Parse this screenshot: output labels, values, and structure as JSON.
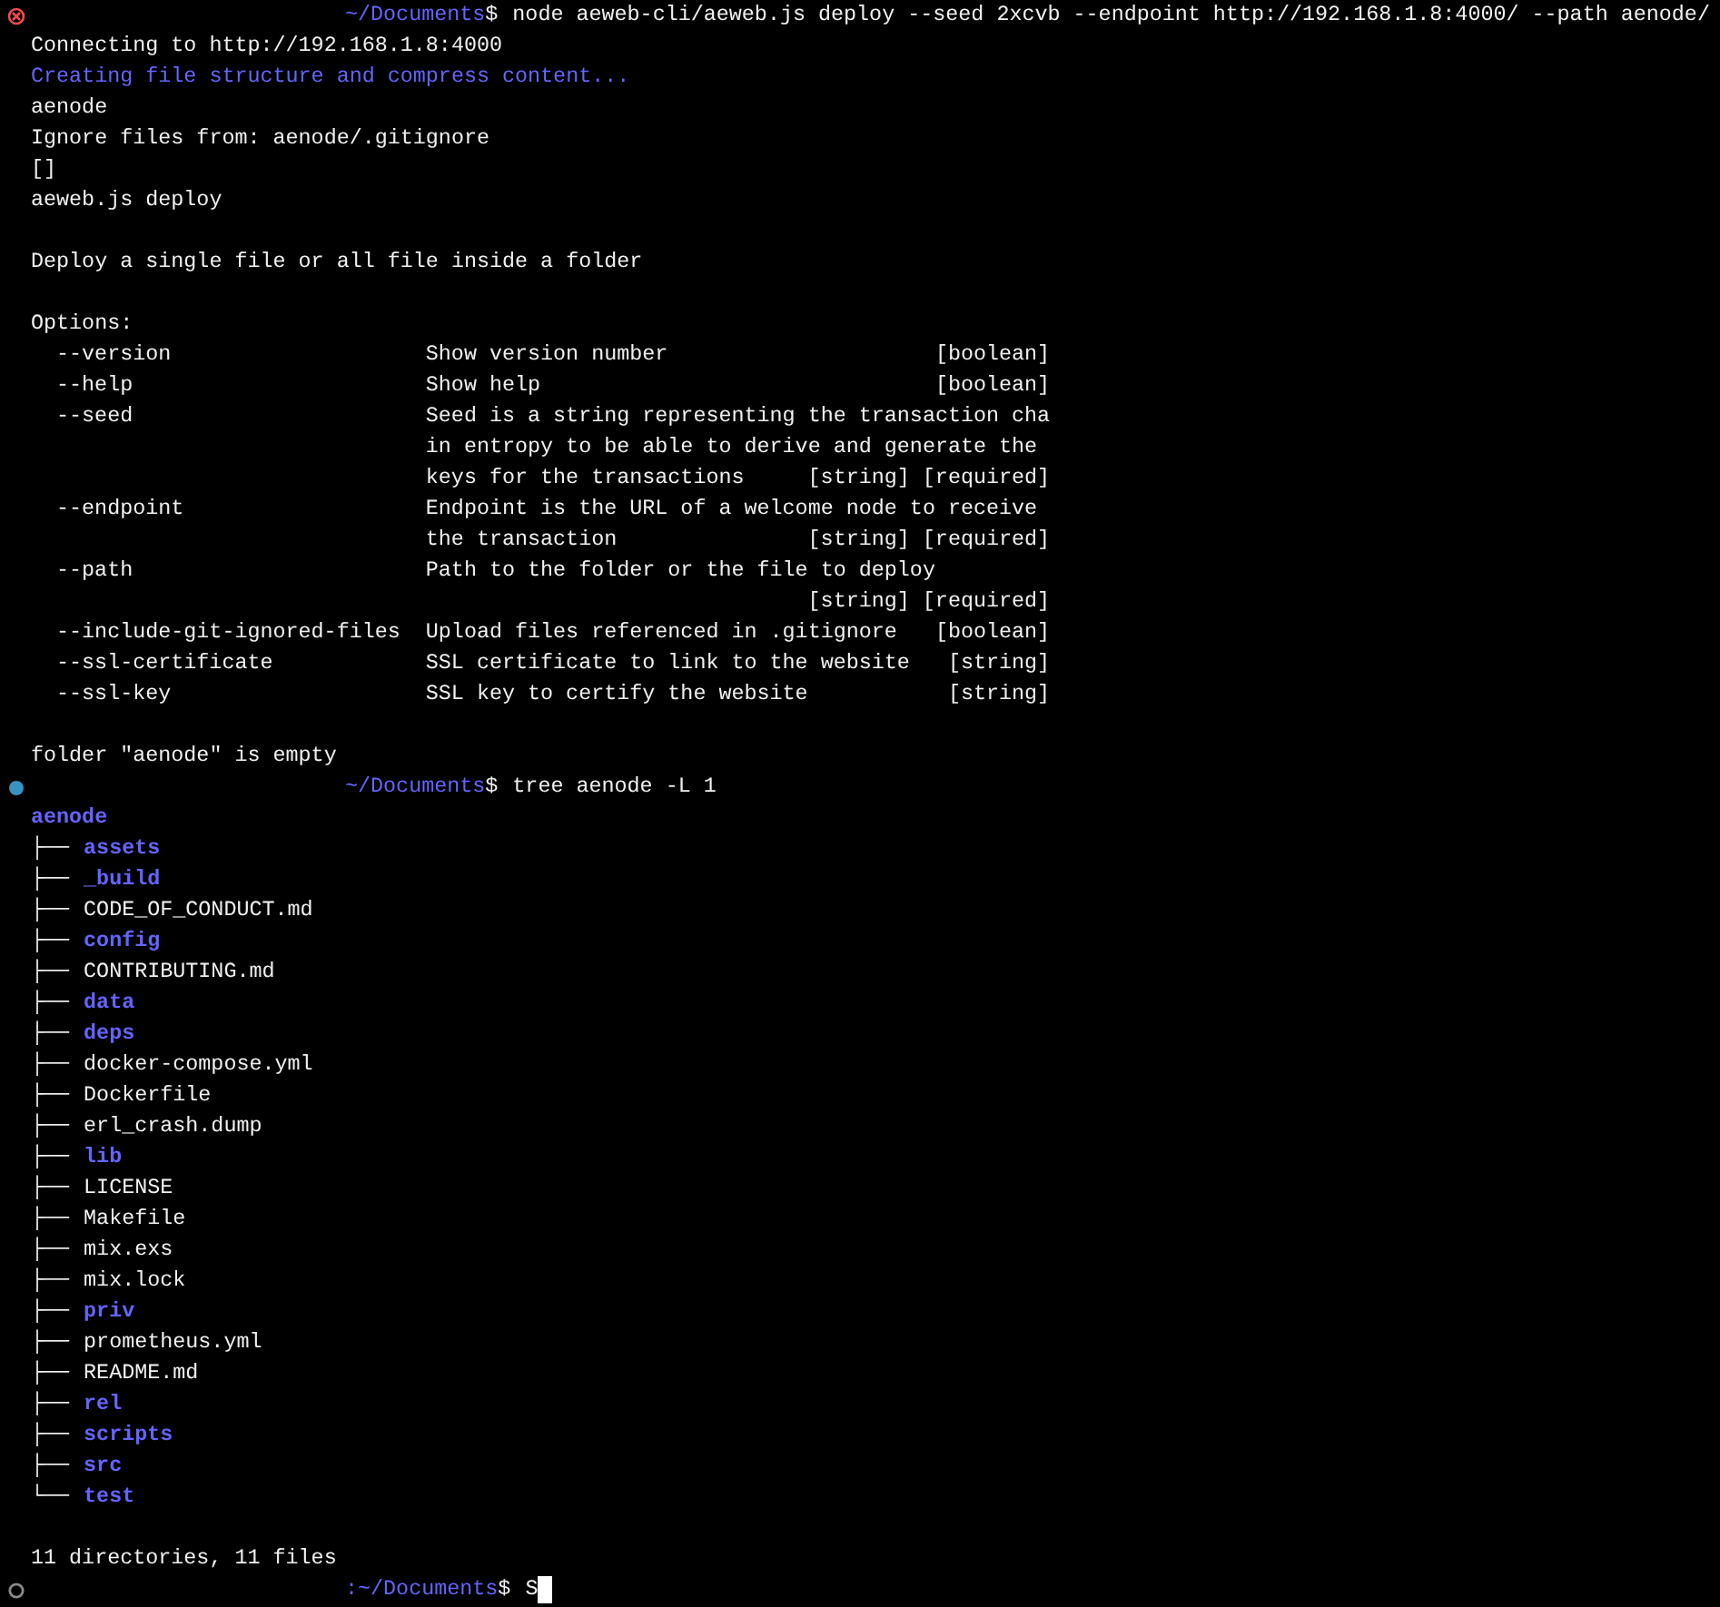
{
  "blocks": [
    {
      "kind": "prompt",
      "finished": true,
      "failed": true,
      "path": "~/Documents",
      "sign": "$",
      "command": "node aeweb-cli/aeweb.js deploy --seed 2xcvb --endpoint http://192.168.1.8:4000/ --path aenode/"
    },
    {
      "kind": "line",
      "text": "Connecting to http://192.168.1.8:4000"
    },
    {
      "kind": "line",
      "highlighted": true,
      "text": "Creating file structure and compress content..."
    },
    {
      "kind": "line",
      "text": "aenode"
    },
    {
      "kind": "line",
      "text": "Ignore files from: aenode/.gitignore"
    },
    {
      "kind": "line",
      "text": "[]"
    },
    {
      "kind": "line",
      "text": "aeweb.js deploy"
    },
    {
      "kind": "blank"
    },
    {
      "kind": "line",
      "text": "Deploy a single file or all file inside a folder"
    },
    {
      "kind": "blank"
    },
    {
      "kind": "line",
      "text": "Options:"
    },
    {
      "kind": "options",
      "items": [
        {
          "flag": "--version",
          "description": [
            "Show version number"
          ],
          "types": "[boolean]"
        },
        {
          "flag": "--help",
          "description": [
            "Show help"
          ],
          "types": "[boolean]"
        },
        {
          "flag": "--seed",
          "description": [
            "Seed is a string representing the transaction cha",
            "in entropy to be able to derive and generate the",
            "keys for the transactions"
          ],
          "types": "[string] [required]"
        },
        {
          "flag": "--endpoint",
          "description": [
            "Endpoint is the URL of a welcome node to receive",
            "the transaction"
          ],
          "types": "[string] [required]"
        },
        {
          "flag": "--path",
          "description": [
            "Path to the folder or the file to deploy"
          ],
          "types": "[string] [required]"
        },
        {
          "flag": "--include-git-ignored-files",
          "description": [
            "Upload files referenced in .gitignore"
          ],
          "types": "[boolean]"
        },
        {
          "flag": "--ssl-certificate",
          "description": [
            "SSL certificate to link to the website"
          ],
          "types": "[string]"
        },
        {
          "flag": "--ssl-key",
          "description": [
            "SSL key to certify the website"
          ],
          "types": "[string]"
        }
      ]
    },
    {
      "kind": "blank"
    },
    {
      "kind": "line",
      "text": "folder \"aenode\" is empty"
    },
    {
      "kind": "prompt",
      "finished": true,
      "failed": false,
      "path": "~/Documents",
      "sign": "$",
      "command": "tree aenode -L 1"
    },
    {
      "kind": "tree",
      "root": "aenode",
      "children": [
        {
          "branch": "├──",
          "name": "assets",
          "kind": "dir"
        },
        {
          "branch": "├──",
          "name": "_build",
          "kind": "dir"
        },
        {
          "branch": "├──",
          "name": "CODE_OF_CONDUCT.md",
          "kind": "file"
        },
        {
          "branch": "├──",
          "name": "config",
          "kind": "dir"
        },
        {
          "branch": "├──",
          "name": "CONTRIBUTING.md",
          "kind": "file"
        },
        {
          "branch": "├──",
          "name": "data",
          "kind": "dir"
        },
        {
          "branch": "├──",
          "name": "deps",
          "kind": "dir"
        },
        {
          "branch": "├──",
          "name": "docker-compose.yml",
          "kind": "file"
        },
        {
          "branch": "├──",
          "name": "Dockerfile",
          "kind": "file"
        },
        {
          "branch": "├──",
          "name": "erl_crash.dump",
          "kind": "file"
        },
        {
          "branch": "├──",
          "name": "lib",
          "kind": "dir"
        },
        {
          "branch": "├──",
          "name": "LICENSE",
          "kind": "file"
        },
        {
          "branch": "├──",
          "name": "Makefile",
          "kind": "file"
        },
        {
          "branch": "├──",
          "name": "mix.exs",
          "kind": "file"
        },
        {
          "branch": "├──",
          "name": "mix.lock",
          "kind": "file"
        },
        {
          "branch": "├──",
          "name": "priv",
          "kind": "dir"
        },
        {
          "branch": "├──",
          "name": "prometheus.yml",
          "kind": "file"
        },
        {
          "branch": "├──",
          "name": "README.md",
          "kind": "file"
        },
        {
          "branch": "├──",
          "name": "rel",
          "kind": "dir"
        },
        {
          "branch": "├──",
          "name": "scripts",
          "kind": "dir"
        },
        {
          "branch": "├──",
          "name": "src",
          "kind": "dir"
        },
        {
          "branch": "└──",
          "name": "test",
          "kind": "dir"
        }
      ]
    },
    {
      "kind": "blank"
    },
    {
      "kind": "line",
      "text": "11 directories, 11 files"
    },
    {
      "kind": "prompt",
      "finished": false,
      "path": ":~/Documents",
      "sign": "$",
      "command": "S",
      "cursor": true
    }
  ]
}
